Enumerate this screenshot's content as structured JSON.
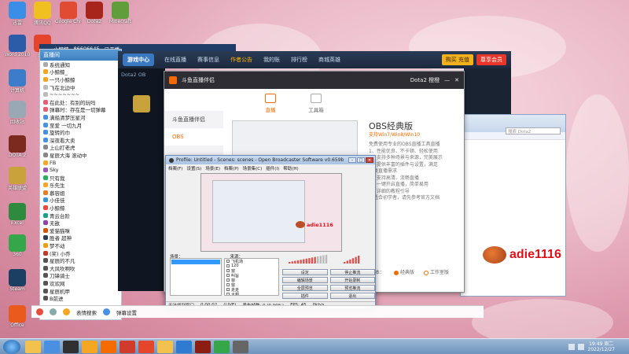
{
  "desktop": {
    "icons": [
      {
        "label": "迅雷",
        "color": "#3a8ee6"
      },
      {
        "label": "腾讯QQ",
        "color": "#f0c020"
      },
      {
        "label": "Google Chrome",
        "color": "#e04b33"
      },
      {
        "label": "Dota2",
        "color": "#a8251b"
      },
      {
        "label": "Minecraft",
        "color": "#5f9e3a"
      },
      {
        "label": "Word 2010",
        "color": "#2c5ba8"
      },
      {
        "label": "网易",
        "color": "#e4452b"
      },
      {
        "label": "计算机",
        "color": "#3d7cc9"
      },
      {
        "label": "回收站",
        "color": "#9aa7b5"
      },
      {
        "label": "DOTA 2",
        "color": "#7c2a1f"
      },
      {
        "label": "英雄联盟",
        "color": "#c9a23b"
      },
      {
        "label": "Excel",
        "color": "#2e8a3e"
      },
      {
        "label": "360",
        "color": "#35a64a"
      },
      {
        "label": "Steam",
        "color": "#1b3f63"
      },
      {
        "label": "Office",
        "color": "#e85b1d"
      }
    ]
  },
  "topstrip": {
    "items": [
      "小鲸鲸",
      "86606645",
      "已开播"
    ]
  },
  "chat": {
    "header": "直播间",
    "rows": [
      {
        "text": "系统通知",
        "color": "#aaa"
      },
      {
        "text": "小鲸鲸_",
        "color": "#f5a623"
      },
      {
        "text": "一只小鲸鲸",
        "color": "#f5a623"
      },
      {
        "text": "飞在北边中",
        "color": "#bbb"
      },
      {
        "text": "~~~~~~~",
        "color": "#bbb"
      },
      {
        "text": "在此处：有别的玩吗",
        "color": "#e85d75"
      },
      {
        "text": "弹幕时：存在是一切弹幕",
        "color": "#e85d75"
      },
      {
        "text": "满船清梦压星河",
        "color": "#4a90e2"
      },
      {
        "text": "至爱 一切九月",
        "color": "#4a90e2"
      },
      {
        "text": "旋转的巾",
        "color": "#4a90e2"
      },
      {
        "text": "深夜看大卖",
        "color": "#4a90e2"
      },
      {
        "text": "上山打老虎",
        "color": "#888"
      },
      {
        "text": "星辰大海 滚动中",
        "color": "#888"
      },
      {
        "text": "FB",
        "color": "#f5a623"
      },
      {
        "text": "Sky",
        "color": "#9b59b6"
      },
      {
        "text": "只有我",
        "color": "#27ae60"
      },
      {
        "text": "乐先生",
        "color": "#f5a623"
      },
      {
        "text": "慕容姐",
        "color": "#e67e22"
      },
      {
        "text": "小佳佳",
        "color": "#3498db"
      },
      {
        "text": "小鲸鲸",
        "color": "#e74c3c"
      },
      {
        "text": "青云台阶",
        "color": "#16a085"
      },
      {
        "text": "无敌",
        "color": "#8e44ad"
      },
      {
        "text": "爱猫猫咪",
        "color": "#d35400"
      },
      {
        "text": "胜者 超神",
        "color": "#2c3e50"
      },
      {
        "text": "梦不动",
        "color": "#f39c12"
      },
      {
        "text": "(奖) 小乔",
        "color": "#c0392b"
      },
      {
        "text": "星辰的不凡",
        "color": "#555"
      },
      {
        "text": "大风吹啊吹",
        "color": "#555"
      },
      {
        "text": "刀锋骑士",
        "color": "#555"
      },
      {
        "text": "欢欢网",
        "color": "#555"
      },
      {
        "text": "星辰机甲",
        "color": "#555"
      },
      {
        "text": "B前进",
        "color": "#555"
      }
    ]
  },
  "game": {
    "logo": "游戏中心",
    "nav": [
      "在线直播",
      "赛事信息",
      "作者公告",
      "我的账",
      "排行榜",
      "商城英雄"
    ],
    "active_nav": 2,
    "recharge": "购买 充值",
    "vip": "尊享会员",
    "side_label": "Dota2 OB"
  },
  "douyu": {
    "title": "斗鱼直播伴侣",
    "user": "Dota2 橙橙",
    "tabs": [
      {
        "label": "直播"
      },
      {
        "label": "工具箱"
      }
    ],
    "sidebar": [
      "斗鱼直播伴侣",
      "OBS"
    ],
    "info_title": "OBS经典版",
    "info_version": "支持Win7/Win8/Win10",
    "info_lines": [
      "免费使用专业的OBS直播工具直播",
      "1、性能优良、不卡顿、轻松使用",
      "2、支持多种场景与来源，完美展示",
      "3、提供丰富的插件与设置，满足",
      "各类直播需求",
      "4、支持高清、流畅直播",
      "5、一键开启直播，简单易用",
      "6、详细的教程引导",
      "不适合初学者，请先参考官方文档"
    ],
    "radio_label": "版本：",
    "radio_options": [
      "经典版",
      "工作室版"
    ],
    "radio_selected": 0
  },
  "explorer": {
    "search_placeholder": "搜索 Dota2"
  },
  "watermark": {
    "text": "adie1116"
  },
  "obs": {
    "title": "Profile: Untitled - Scenes: scenes - Open Broadcaster Software v0.659b",
    "menu": [
      "档案(F)",
      "设置(S)",
      "场景(E)",
      "档案(P)",
      "场景集(C)",
      "插件(I)",
      "帮助(H)"
    ],
    "scenes_label": "场景：",
    "sources_label": "来源：",
    "sources": [
      "飞机场",
      "120",
      "窗",
      "叫旨",
      "窗",
      "窗",
      "走走",
      "大帽"
    ],
    "buttons": [
      "设定",
      "停止推流",
      "编辑场景",
      "开始录制",
      "全屏预览",
      "预览推流",
      "插件",
      "退出"
    ],
    "status": [
      "无法找到窗口",
      "0:00:02",
      "(LIVE)",
      "丢失帧数: 0 (0.00%)",
      "FPS: 45",
      "0kb/s"
    ]
  },
  "chatbar": {
    "items": [
      "表情搜索",
      "弹幕设置"
    ]
  },
  "taskbar": {
    "apps": [
      {
        "name": "explorer",
        "color": "#f2c14e"
      },
      {
        "name": "chrome",
        "color": "#4a90e2"
      },
      {
        "name": "obs",
        "color": "#303030"
      },
      {
        "name": "qq",
        "color": "#f5a623"
      },
      {
        "name": "douyu",
        "color": "#f56b00"
      },
      {
        "name": "game",
        "color": "#d03b2b"
      },
      {
        "name": "netease",
        "color": "#e4452b"
      },
      {
        "name": "folder",
        "color": "#f2c14e"
      },
      {
        "name": "ie",
        "color": "#2e7bd1"
      },
      {
        "name": "dota2",
        "color": "#8c1d12"
      },
      {
        "name": "360",
        "color": "#35a64a"
      },
      {
        "name": "app",
        "color": "#666"
      }
    ],
    "time": "19:49 周二",
    "date": "2022/12/27"
  }
}
